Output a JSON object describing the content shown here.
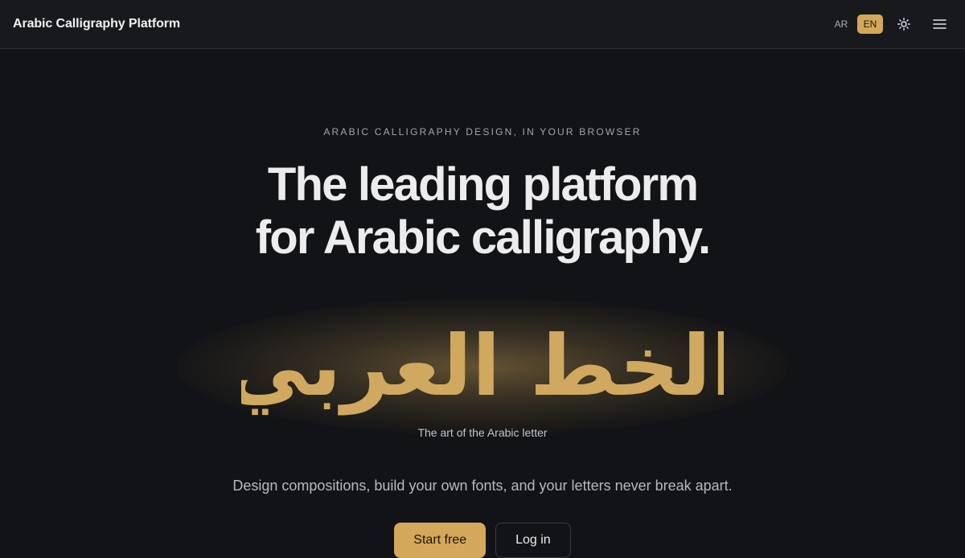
{
  "header": {
    "brand": "Arabic Calligraphy Platform",
    "lang_ar": "AR",
    "lang_en": "EN",
    "theme_icon": "sun-icon",
    "menu_icon": "hamburger-menu-icon"
  },
  "hero": {
    "eyebrow": "ARABIC CALLIGRAPHY DESIGN, IN YOUR BROWSER",
    "headline_line1": "The leading platform",
    "headline_line2": "for Arabic calligraphy.",
    "calligraphy_text": "الخط العربي",
    "caption": "The art of the Arabic letter",
    "subtitle": "Design compositions, build your own fonts, and your letters never break apart.",
    "primary_cta": "Start free",
    "secondary_cta": "Log in"
  },
  "colors": {
    "accent": "#d4a85a",
    "background": "#121316",
    "header_background": "#17191d"
  }
}
